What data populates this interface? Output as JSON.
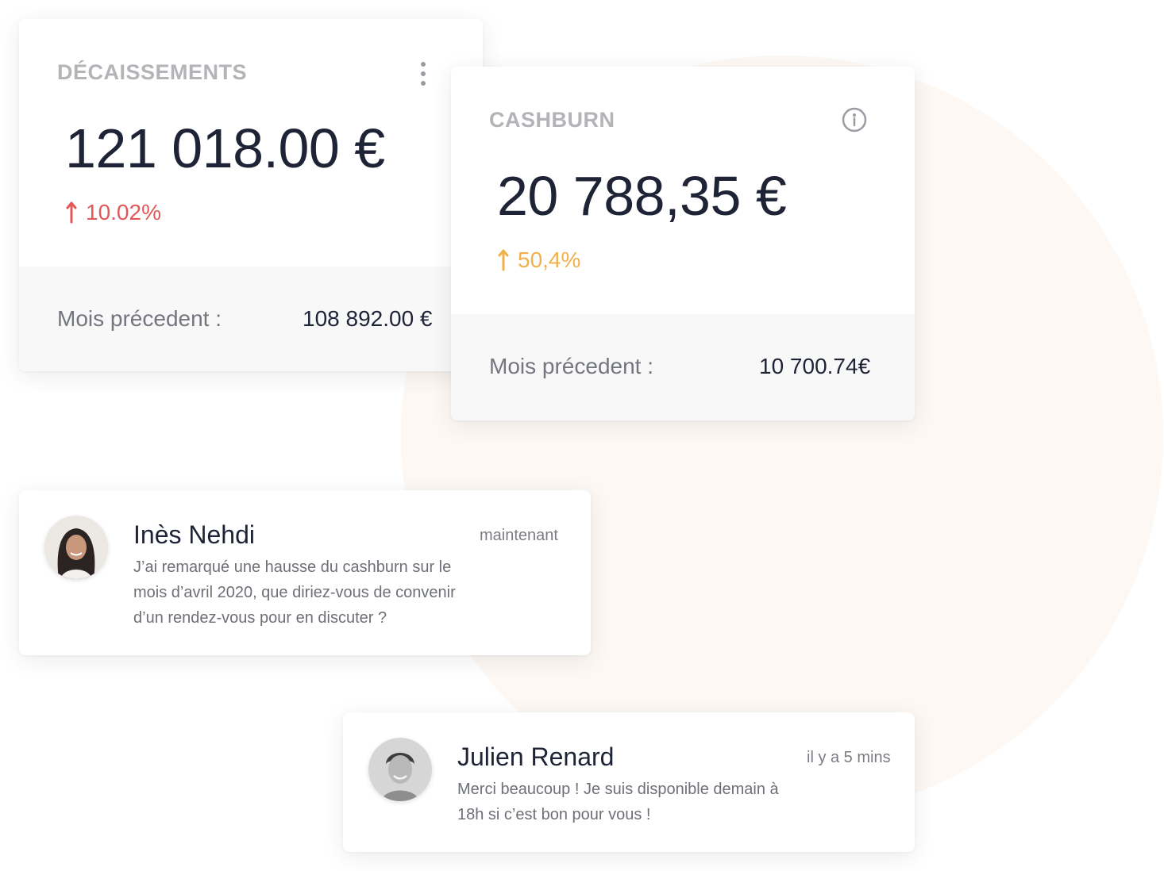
{
  "decaissements": {
    "title": "DÉCAISSEMENTS",
    "value": "121 018.00 €",
    "change": "10.02%",
    "change_direction": "up",
    "change_color": "#e05858",
    "menu_icon": "kebab-menu-icon",
    "prev_label": "Mois précedent :",
    "prev_value": "108 892.00 €"
  },
  "cashburn": {
    "title": "CASHBURN",
    "value": "20 788,35 €",
    "change": "50,4%",
    "change_direction": "up",
    "change_color": "#f0b04a",
    "info_icon": "info-icon",
    "prev_label": "Mois précedent :",
    "prev_value": "10 700.74€"
  },
  "messages": [
    {
      "name": "Inès Nehdi",
      "time": "maintenant",
      "text": "J’ai remarqué une hausse du cashburn sur le mois d’avril 2020, que diriez-vous de convenir d’un rendez-vous pour en discuter ?"
    },
    {
      "name": "Julien Renard",
      "time": "il y a 5 mins",
      "text": "Merci beaucoup ! Je suis disponible demain à 18h si c’est bon pour vous !"
    }
  ],
  "colors": {
    "background_circle": "#fdf8f4",
    "value_text": "#1e2336",
    "title_text": "#b3b3b8"
  }
}
